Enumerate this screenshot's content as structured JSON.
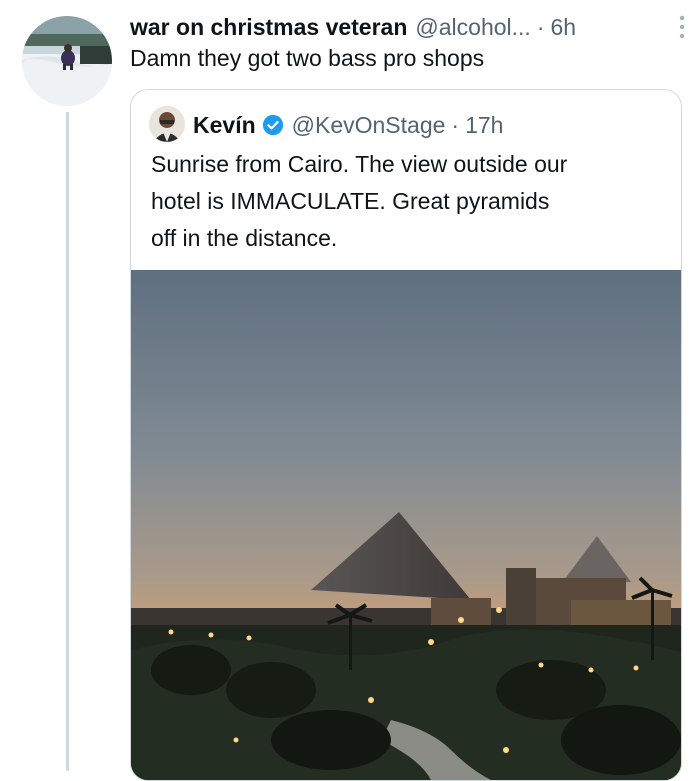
{
  "tweet": {
    "author_name": "war on christmas veteran",
    "handle": "@alcohol...",
    "separator": "·",
    "time": "6h",
    "text": "Damn they got two bass pro shops"
  },
  "quoted_tweet": {
    "author_name": "Kevín",
    "handle": "@KevOnStage",
    "separator": "·",
    "time": "17h",
    "text_lines": [
      "Sunrise from Cairo. The view outside our",
      "hotel is IMMACULATE.  Great pyramids",
      "off in the distance."
    ]
  },
  "colors": {
    "text": "#0f1419",
    "secondary": "#536471",
    "verified": "#1d9bf0",
    "border": "#cfd9de"
  },
  "icons": {
    "verified": "verified-badge-icon",
    "more": "more-vertical-icon"
  }
}
